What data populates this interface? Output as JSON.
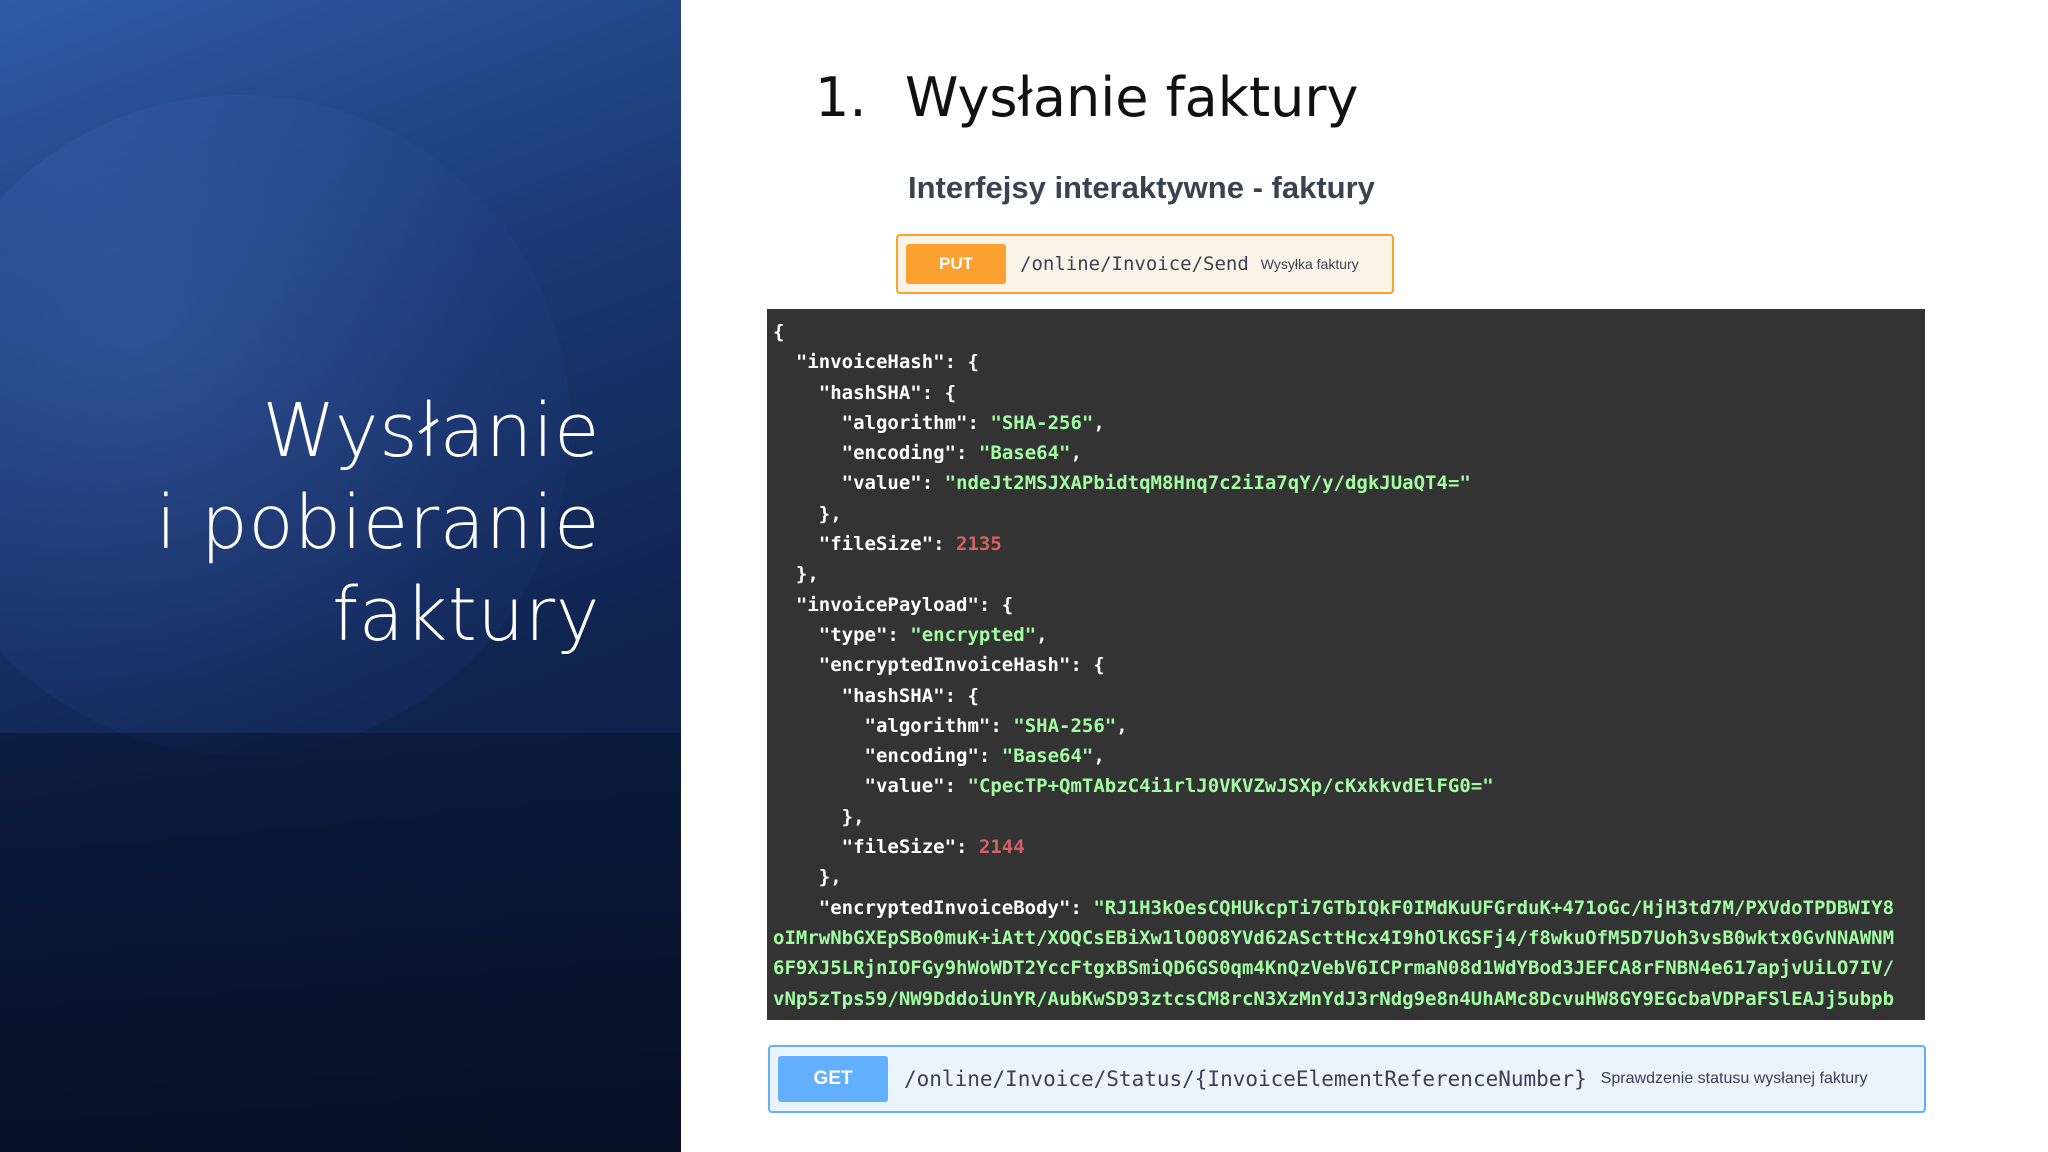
{
  "slide": {
    "side_title": [
      "Wysłanie",
      "i pobieranie",
      "faktury"
    ],
    "heading_number": "1.",
    "heading_text": "Wysłanie faktury",
    "subheading": "Interfejsy interaktywne - faktury"
  },
  "put_op": {
    "method": "PUT",
    "path": "/online/Invoice/Send",
    "description": "Wysyłka faktury"
  },
  "get_op": {
    "method": "GET",
    "path": "/online/Invoice/Status/{InvoiceElementReferenceNumber}",
    "description": "Sprawdzenie statusu wysłanej faktury"
  },
  "code": {
    "algorithm": "SHA-256",
    "encoding": "Base64",
    "invoice_hash_value": "ndeJt2MSJXAPbidtqM8Hnq7c2iIa7qY/y/dgkJUaQT4=",
    "invoice_file_size": "2135",
    "payload_type": "encrypted",
    "encrypted_hash_value": "CpecTP+QmTAbzC4i1rlJ0VKVZwJSXp/cKxkkvdElFG0=",
    "encrypted_file_size": "2144",
    "encrypted_body_lines": [
      "RJ1H3kOesCQHUkcpTi7GTbIQkF0IMdKuUFGrduK+471oGc/HjH3td7M/PXVdoTPDBWIY8",
      "oIMrwNbGXEpSBo0muK+iAtt/XOQCsEBiXw1lO0O8YVd62AScttHcx4I9hOlKGSFj4/f8wkuOfM5D7Uoh3vsB0wktx0GvNNAWNM",
      "6F9XJ5LRjnIOFGy9hWoWDT2YccFtgxBSmiQD6GS0qm4KnQzVebV6ICPrmaN08d1WdYBod3JEFCA8rFNBN4e617apjvUiLO7IV/",
      "vNp5zTps59/NW9DddoiUnYR/AubKwSD93ztcsCM8rcN3XzMnYdJ3rNdg9e8n4UhAMc8DcvuHW8GY9EGcbaVDPaFSlEAJj5ubpb"
    ]
  },
  "colors": {
    "put_accent": "#fca130",
    "get_accent": "#61affe",
    "code_bg": "#333333",
    "string_color": "#a2fca2",
    "number_color": "#d36363"
  }
}
